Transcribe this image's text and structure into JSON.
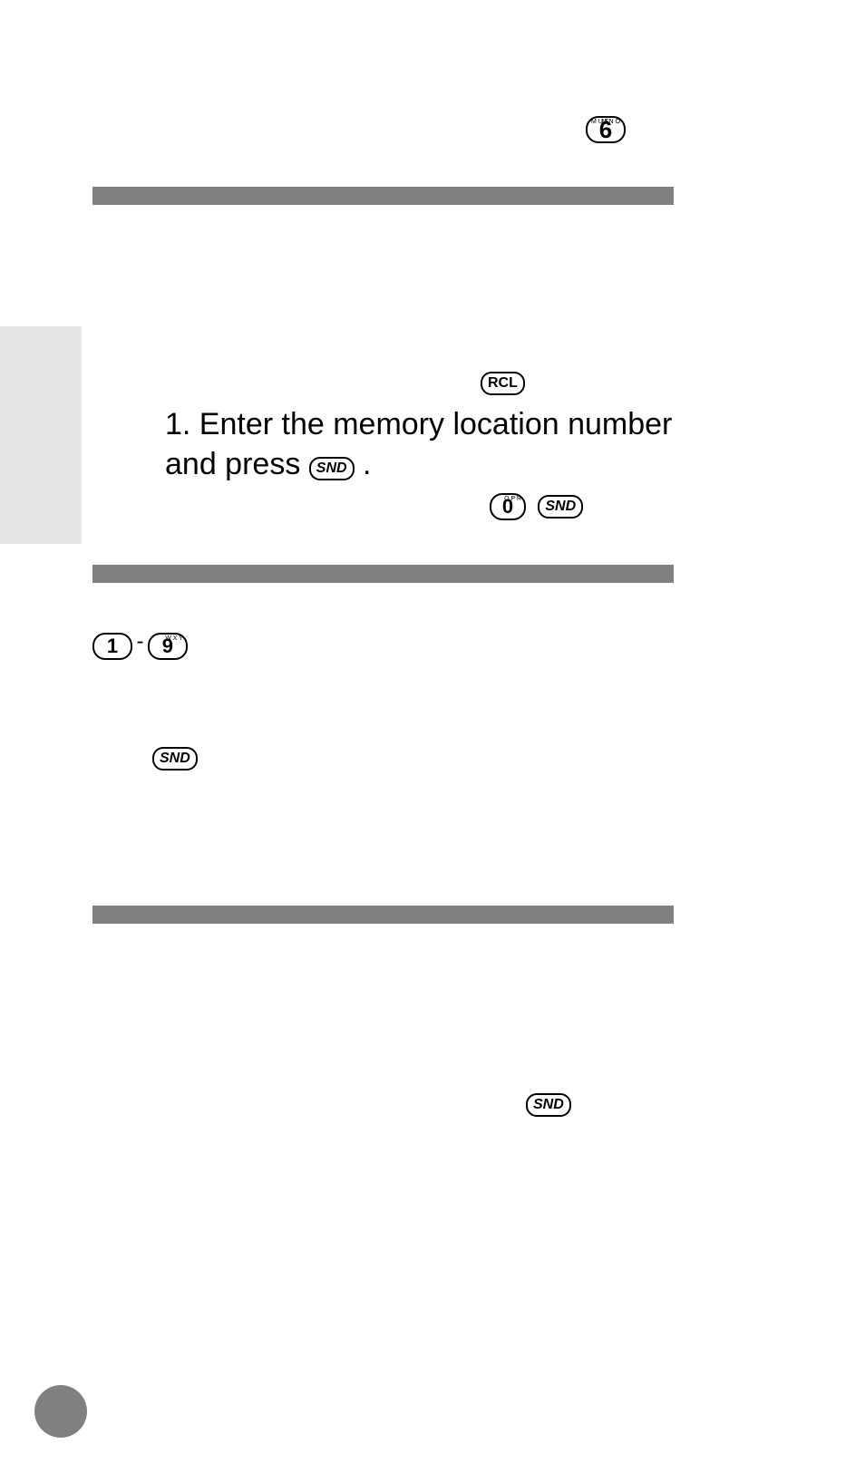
{
  "sidebar": {
    "label": ""
  },
  "top": {
    "key6_label": "6",
    "key6_left": "M\nU\nE",
    "key6_right": "M\nN\nO"
  },
  "section1": {
    "header": "",
    "intro_pre": "",
    "key_rcl": "RCL",
    "step1_pre": "1.  Enter the memory location number and press ",
    "key_snd": "SND",
    "step1_post": ".",
    "example_pre": "",
    "key_0": "0",
    "key_0_sup": "O\nP\nR",
    "key_snd2": "SND"
  },
  "section2": {
    "header": "",
    "key_1": "1",
    "dash": "-",
    "key_9": "9",
    "key_9_sup": "W\nX\nY",
    "intro_post": "",
    "snd_key": "SND",
    "body": ""
  },
  "section3": {
    "header": "",
    "intro": "",
    "snd_key": "SND",
    "body": ""
  },
  "footer": {
    "page": ""
  }
}
